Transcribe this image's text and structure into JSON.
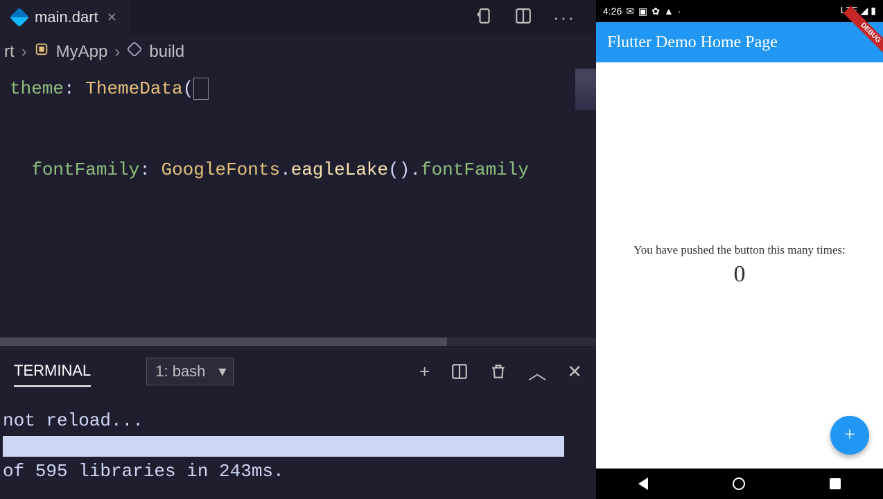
{
  "tab": {
    "filename": "main.dart"
  },
  "breadcrumb": {
    "part0": "rt",
    "class": "MyApp",
    "method": "build"
  },
  "code": {
    "line1_key": "theme",
    "line1_type": "ThemeData",
    "line2_key": "fontFamily",
    "line2_class": "GoogleFonts",
    "line2_method": "eagleLake",
    "line2_prop": "fontFamily"
  },
  "terminal": {
    "tab_label": "TERMINAL",
    "shell": "1: bash",
    "out_line1": "not reload...",
    "out_line2": "of 595 libraries in 243ms."
  },
  "phone": {
    "time": "4:26",
    "signal": "LTE",
    "debug": "DEBUG",
    "app_title": "Flutter Demo Home Page",
    "body_text": "You have pushed the button this many times:",
    "counter": "0"
  }
}
